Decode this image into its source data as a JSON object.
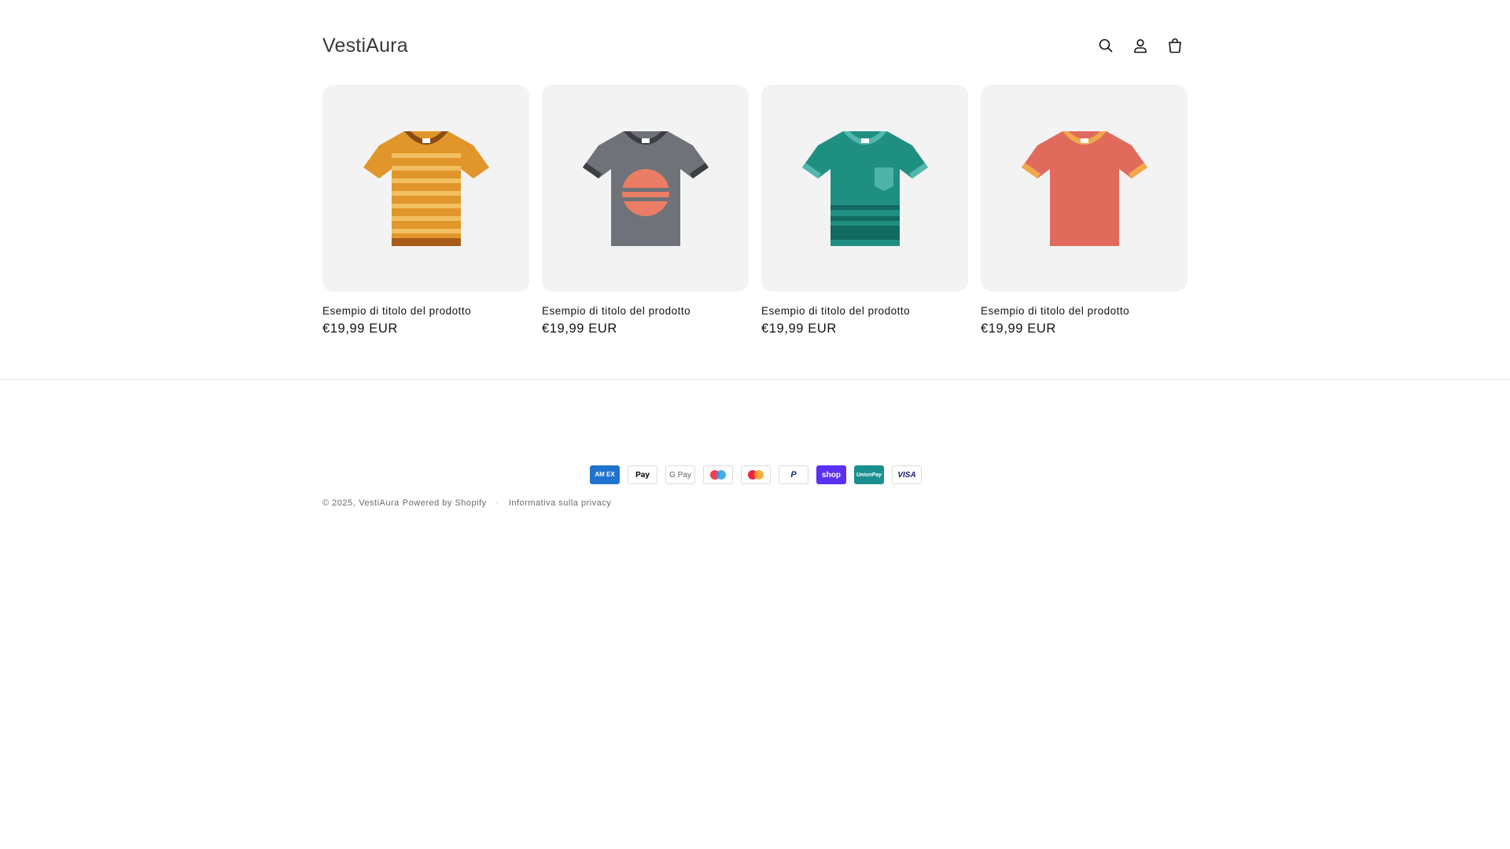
{
  "header": {
    "logo": "VestiAura",
    "icons": [
      "search-icon",
      "account-icon",
      "cart-icon"
    ]
  },
  "products": [
    {
      "title": "Esempio di titolo del prodotto",
      "price": "€19,99 EUR",
      "image": "striped-orange-tshirt"
    },
    {
      "title": "Esempio di titolo del prodotto",
      "price": "€19,99 EUR",
      "image": "gray-sunset-tshirt"
    },
    {
      "title": "Esempio di titolo del prodotto",
      "price": "€19,99 EUR",
      "image": "teal-pocket-tshirt"
    },
    {
      "title": "Esempio di titolo del prodotto",
      "price": "€19,99 EUR",
      "image": "coral-ringer-tshirt"
    }
  ],
  "payments": {
    "amex": "AM EX",
    "apple": " Pay",
    "gpay": "G Pay",
    "paypal": "P",
    "shop": "shop",
    "union": "UnionPay",
    "visa": "VISA",
    "icons": [
      "maestro-icon",
      "mastercard-icon"
    ]
  },
  "footer": {
    "copyright": "© 2025,",
    "store_link": "VestiAura",
    "powered": "Powered by Shopify",
    "separator": "·",
    "privacy": "Informativa sulla privacy"
  },
  "colors": {
    "card_bg": "#f3f3f3",
    "shirt1": "#e0962a",
    "shirt2": "#6f7278",
    "shirt3": "#1f8f82",
    "shirt4": "#e06b5c"
  }
}
